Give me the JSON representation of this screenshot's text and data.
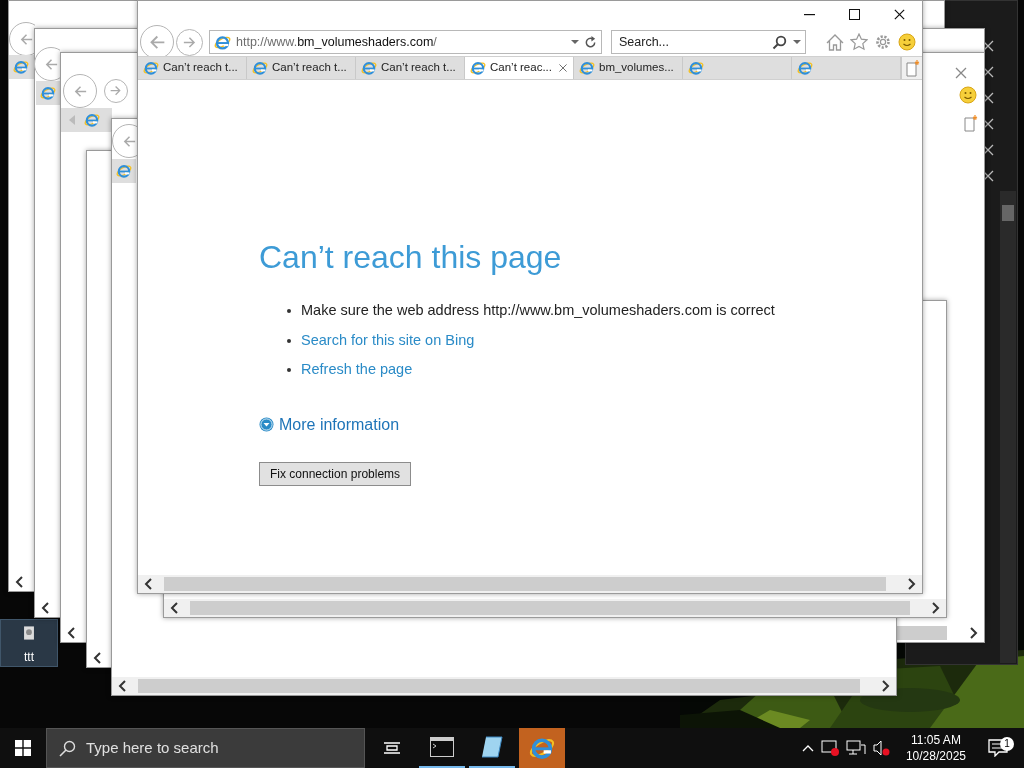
{
  "browser": {
    "address": "http://www.**bm_volumeshaders.com**/",
    "search_placeholder": "Search...",
    "tabs": [
      {
        "label": "Can’t reach t...",
        "selected": false
      },
      {
        "label": "Can’t reach t...",
        "selected": false
      },
      {
        "label": "Can’t reach t...",
        "selected": false
      },
      {
        "label": "Can’t reac...",
        "selected": true
      },
      {
        "label": "bm_volumes...",
        "selected": false
      },
      {
        "selected": false
      },
      {
        "selected": false
      }
    ],
    "page": {
      "heading": "Can’t reach this page",
      "bullets": [
        {
          "kind": "text",
          "text": "Make sure the web address http://www.bm_volumeshaders.com is correct"
        },
        {
          "kind": "link",
          "text": "Search for this site on Bing"
        },
        {
          "kind": "link",
          "text": "Refresh the page"
        }
      ],
      "more_info": "More information",
      "button": "Fix connection problems"
    }
  },
  "desktop_icons": [
    {
      "label": "ttt"
    }
  ],
  "taskbar": {
    "search_placeholder": "Type here to search",
    "apps": [
      {
        "kind": "terminal",
        "running": true,
        "selected": false
      },
      {
        "kind": "notes",
        "running": true,
        "selected": false
      },
      {
        "kind": "browser",
        "running": false,
        "selected": true
      }
    ],
    "time": "11:05 AM",
    "date": "10/28/2025",
    "notifications": "1"
  }
}
